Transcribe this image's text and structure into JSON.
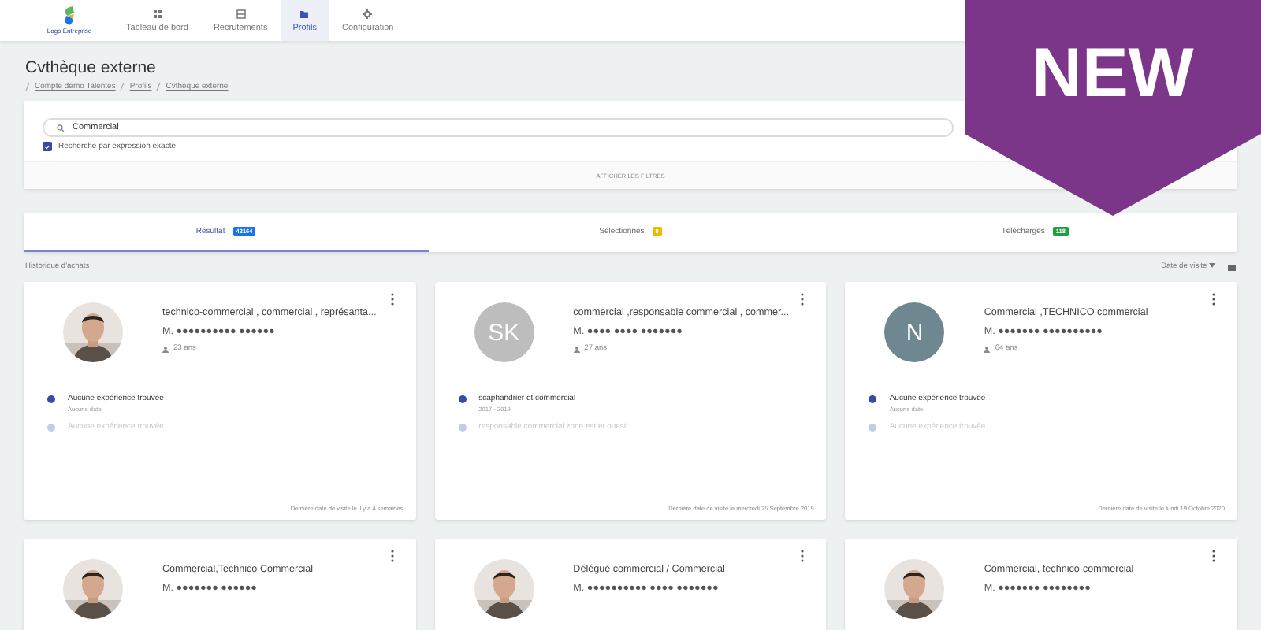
{
  "nav": {
    "logo": "Logo Entreprise",
    "items": [
      {
        "label": "Tableau de bord",
        "selected": false
      },
      {
        "label": "Recrutements",
        "selected": false
      },
      {
        "label": "Profils",
        "selected": true
      },
      {
        "label": "Configuration",
        "selected": false
      }
    ]
  },
  "page": {
    "title": "Cvthèque externe",
    "breadcrumb": [
      "Compte démo Talentes",
      "Profils",
      "Cvthèque externe"
    ]
  },
  "search": {
    "value": "Commercial",
    "exact_match": {
      "label": "Recherche par expression exacte",
      "checked": true
    },
    "filters_toggle": "AFFICHER LES FILTRES"
  },
  "tabs": [
    {
      "label": "Résultat",
      "badge": "42164",
      "color": "#1a73e8",
      "selected": true
    },
    {
      "label": "Sélectionnés",
      "badge": "0",
      "color": "#f2b705",
      "selected": false
    },
    {
      "label": "Téléchargés",
      "badge": "118",
      "color": "#1e9e3e",
      "selected": false
    }
  ],
  "history_label": "Historique d'achats",
  "sort": "Date de visite",
  "profiles": [
    {
      "avatar": {
        "kind": "picture"
      },
      "title": "technico-commercial , commercial , représanta...",
      "name": "M. ●●●●●●●●●● ●●●●●●",
      "age": "23 ans",
      "experiences": [
        {
          "title": "Aucune expérience trouvée",
          "date": "Aucune date",
          "active": true
        },
        {
          "title": "Aucune expérience trouvée",
          "active": false
        }
      ],
      "last_visit": "Dernière date de visite le il y a 4 semaines"
    },
    {
      "avatar": {
        "kind": "initials",
        "text": "SK",
        "color": "#bdbdbd"
      },
      "title": "commercial ,responsable commercial , commer...",
      "name": "M. ●●●● ●●●● ●●●●●●●",
      "age": "27 ans",
      "experiences": [
        {
          "title": "scaphandrier et commercial",
          "date": "2017 - 2019",
          "active": true
        },
        {
          "title": "responsable commercial zone est et ouest",
          "active": false
        }
      ],
      "last_visit": "Dernière date de visite le mercredi 25 Septembre 2019"
    },
    {
      "avatar": {
        "kind": "initials",
        "text": "N",
        "color": "#6f8791"
      },
      "title": "Commercial ,TECHNICO commercial",
      "name": "M. ●●●●●●● ●●●●●●●●●●",
      "age": "64 ans",
      "experiences": [
        {
          "title": "Aucune expérience trouvée",
          "date": "Aucune date",
          "active": true
        },
        {
          "title": "Aucune expérience trouvée",
          "active": false
        }
      ],
      "last_visit": "Dernière date de visite le lundi 19 Octobre 2020"
    },
    {
      "avatar": {
        "kind": "picture"
      },
      "title": "Commercial,Technico Commercial",
      "name": "M. ●●●●●●● ●●●●●●"
    },
    {
      "avatar": {
        "kind": "picture"
      },
      "title": "Délégué commercial / Commercial",
      "name": "M. ●●●●●●●●●● ●●●● ●●●●●●●"
    },
    {
      "avatar": {
        "kind": "picture"
      },
      "title": "Commercial, technico-commercial",
      "name": "M. ●●●●●●● ●●●●●●●●"
    }
  ],
  "ribbon": "NEW"
}
